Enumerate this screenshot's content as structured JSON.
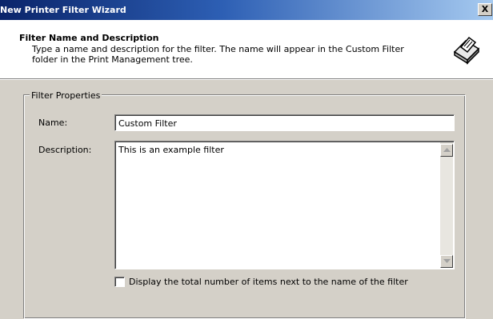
{
  "window": {
    "title": "New Printer Filter Wizard",
    "close_glyph": "X"
  },
  "header": {
    "title": "Filter Name and Description",
    "subtitle": "Type a name and description for the filter. The name will appear in the Custom Filter folder in the Print Management tree.",
    "icon": "printer-icon"
  },
  "group": {
    "label": "Filter Properties",
    "name_label": "Name:",
    "name_value": "Custom Filter",
    "description_label": "Description:",
    "description_value": "This is an example filter",
    "checkbox_label": "Display the total number of items next to the name of the filter",
    "checkbox_checked": false
  }
}
